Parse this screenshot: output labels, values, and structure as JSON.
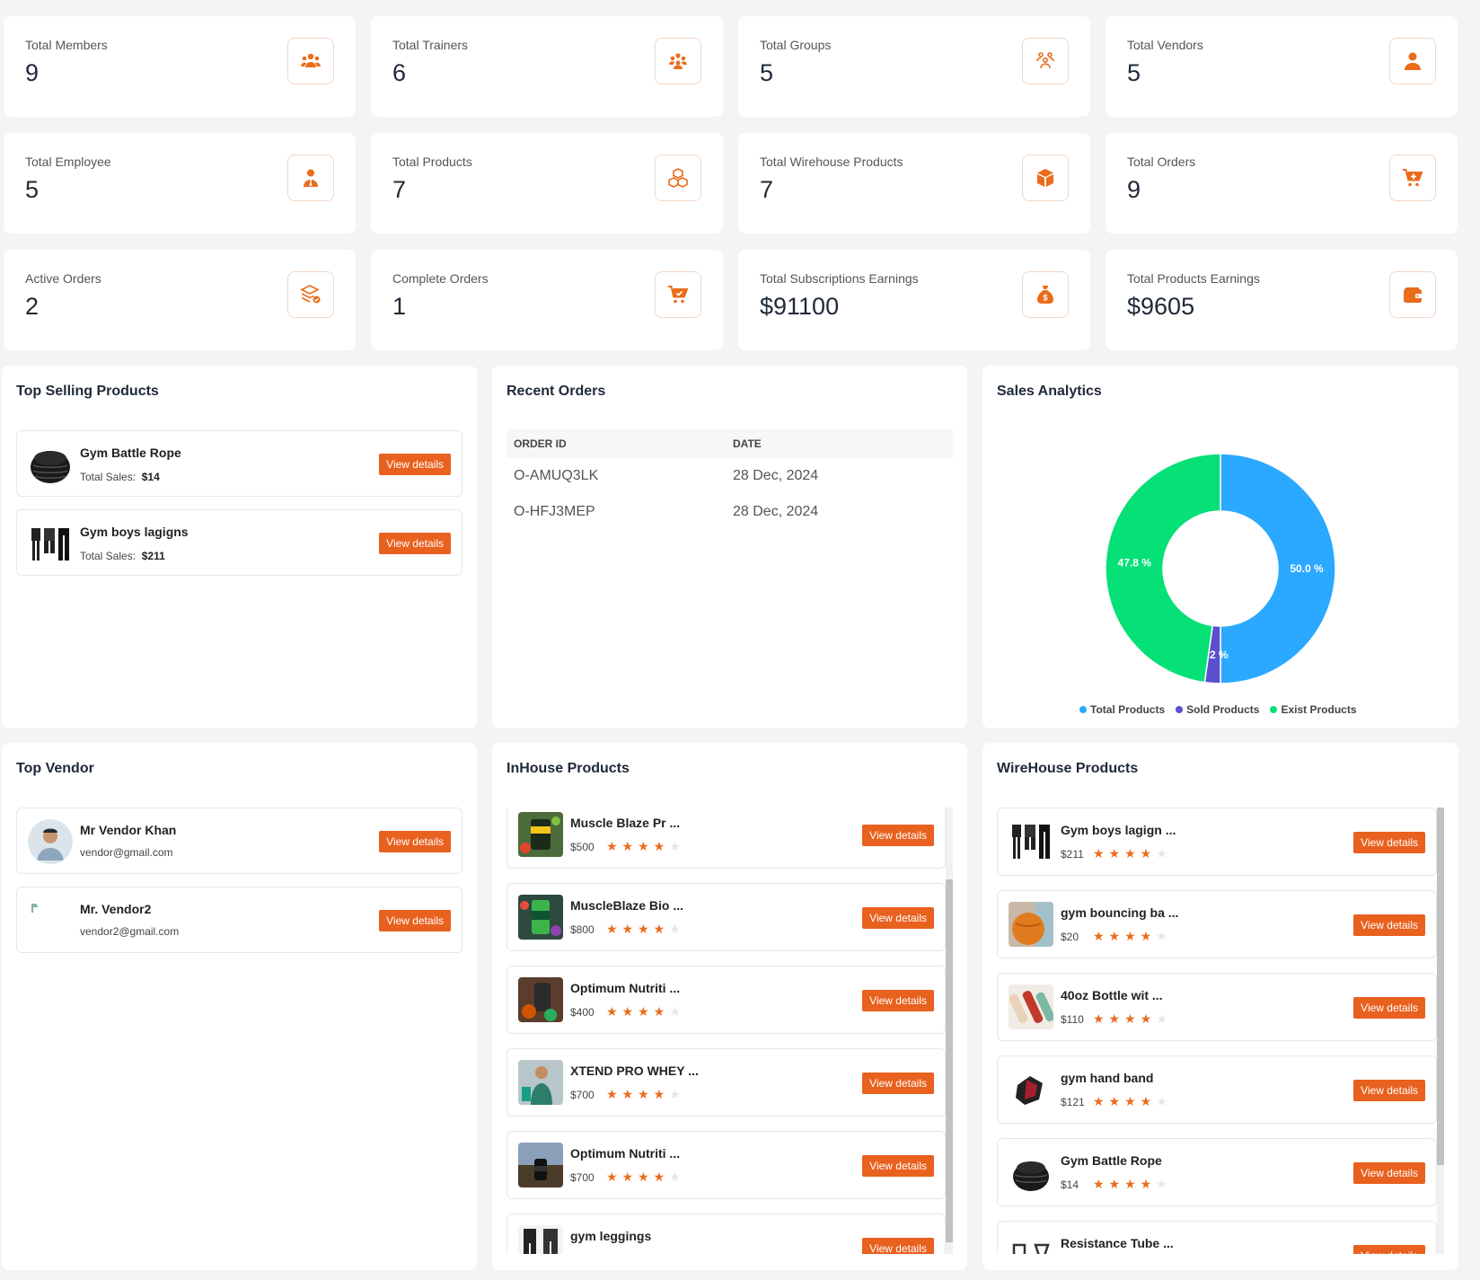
{
  "stats": [
    {
      "label": "Total Members",
      "value": "9",
      "icon": "users-icon"
    },
    {
      "label": "Total Trainers",
      "value": "6",
      "icon": "group-icon"
    },
    {
      "label": "Total Groups",
      "value": "5",
      "icon": "team-icon"
    },
    {
      "label": "Total Vendors",
      "value": "5",
      "icon": "user-icon"
    },
    {
      "label": "Total Employee",
      "value": "5",
      "icon": "employee-icon"
    },
    {
      "label": "Total Products",
      "value": "7",
      "icon": "cubes-icon"
    },
    {
      "label": "Total Wirehouse Products",
      "value": "7",
      "icon": "box-icon"
    },
    {
      "label": "Total Orders",
      "value": "9",
      "icon": "cart-plus-icon"
    },
    {
      "label": "Active Orders",
      "value": "2",
      "icon": "layers-check-icon"
    },
    {
      "label": "Complete Orders",
      "value": "1",
      "icon": "cart-check-icon"
    },
    {
      "label": "Total Subscriptions Earnings",
      "value": "$91100",
      "icon": "money-bag-icon"
    },
    {
      "label": "Total Products Earnings",
      "value": "$9605",
      "icon": "wallet-icon"
    }
  ],
  "top_selling": {
    "title": "Top Selling Products",
    "sales_label": "Total Sales:",
    "items": [
      {
        "name": "Gym Battle Rope",
        "sales": "$14",
        "button": "View details"
      },
      {
        "name": "Gym boys lagigns",
        "sales": "$211",
        "button": "View details"
      }
    ]
  },
  "recent_orders": {
    "title": "Recent Orders",
    "columns": [
      "ORDER ID",
      "DATE"
    ],
    "rows": [
      [
        "O-AMUQ3LK",
        "28 Dec, 2024"
      ],
      [
        "O-HFJ3MEP",
        "28 Dec, 2024"
      ]
    ]
  },
  "sales_analytics": {
    "title": "Sales Analytics",
    "legend": [
      "Total Products",
      "Sold Products",
      "Exist Products"
    ],
    "colors": {
      "total": "#2ba8ff",
      "sold": "#5a4fcf",
      "exist": "#05e077"
    }
  },
  "chart_data": {
    "type": "pie",
    "title": "Sales Analytics",
    "categories": [
      "Total Products",
      "Sold Products",
      "Exist Products"
    ],
    "values": [
      50.0,
      2.2,
      47.8
    ],
    "labels": [
      "50.0 %",
      "2.2 %",
      "47.8 %"
    ],
    "legend": "bottom"
  },
  "top_vendor": {
    "title": "Top Vendor",
    "items": [
      {
        "name": "Mr Vendor Khan",
        "email": "vendor@gmail.com",
        "button": "View details"
      },
      {
        "name": "Mr. Vendor2",
        "email": "vendor2@gmail.com",
        "button": "View details"
      }
    ]
  },
  "inhouse": {
    "title": "InHouse Products",
    "items": [
      {
        "name": "Muscle Blaze Pr ...",
        "price": "$500",
        "rating": 4,
        "button": "View details"
      },
      {
        "name": "MuscleBlaze Bio ...",
        "price": "$800",
        "rating": 4,
        "button": "View details"
      },
      {
        "name": "Optimum Nutriti ...",
        "price": "$400",
        "rating": 4,
        "button": "View details"
      },
      {
        "name": "XTEND PRO WHEY ...",
        "price": "$700",
        "rating": 4,
        "button": "View details"
      },
      {
        "name": "Optimum Nutriti ...",
        "price": "$700",
        "rating": 4,
        "button": "View details"
      },
      {
        "name": "gym leggings",
        "price": "",
        "rating": 0,
        "button": "View details"
      }
    ]
  },
  "wirehouse": {
    "title": "WireHouse Products",
    "items": [
      {
        "name": "Gym boys lagign ...",
        "price": "$211",
        "rating": 4,
        "button": "View details"
      },
      {
        "name": "gym bouncing ba ...",
        "price": "$20",
        "rating": 4,
        "button": "View details"
      },
      {
        "name": "40oz Bottle wit ...",
        "price": "$110",
        "rating": 4,
        "button": "View details"
      },
      {
        "name": "gym hand band",
        "price": "$121",
        "rating": 4,
        "button": "View details"
      },
      {
        "name": "Gym Battle Rope",
        "price": "$14",
        "rating": 4,
        "button": "View details"
      },
      {
        "name": "Resistance Tube ...",
        "price": "",
        "rating": 0,
        "button": "View details"
      }
    ]
  }
}
